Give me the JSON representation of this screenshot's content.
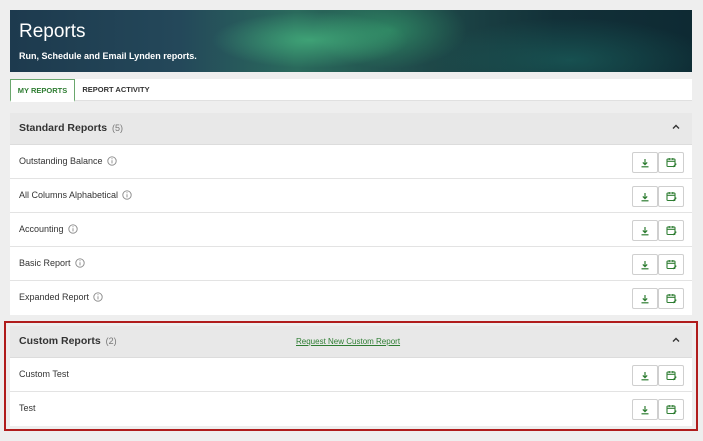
{
  "banner": {
    "title": "Reports",
    "subtitle": "Run, Schedule and Email Lynden reports."
  },
  "tabs": [
    {
      "label": "MY REPORTS",
      "active": true
    },
    {
      "label": "REPORT ACTIVITY",
      "active": false
    }
  ],
  "standard": {
    "title": "Standard Reports",
    "count": "(5)",
    "items": [
      {
        "label": "Outstanding Balance"
      },
      {
        "label": "All Columns Alphabetical"
      },
      {
        "label": "Accounting"
      },
      {
        "label": "Basic Report"
      },
      {
        "label": "Expanded Report"
      }
    ]
  },
  "custom": {
    "title": "Custom Reports",
    "count": "(2)",
    "link": "Request New Custom Report",
    "items": [
      {
        "label": "Custom Test"
      },
      {
        "label": "Test"
      }
    ]
  },
  "colors": {
    "accent": "#2e7d32",
    "highlight": "#b01c1c",
    "header_bg": "#e8e8e8"
  }
}
